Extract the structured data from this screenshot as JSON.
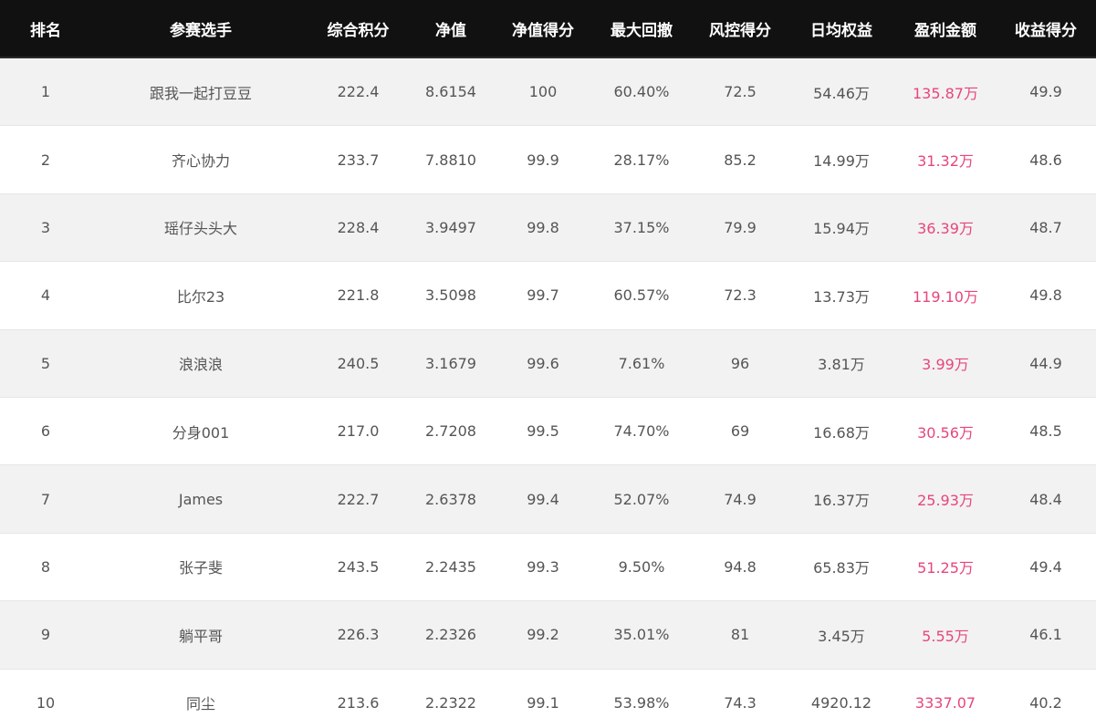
{
  "headers": [
    "排名",
    "参赛选手",
    "综合积分",
    "净值",
    "净值得分",
    "最大回撤",
    "风控得分",
    "日均权益",
    "盈利金额",
    "收益得分"
  ],
  "rows": [
    [
      "1",
      "跟我一起打豆豆",
      "222.4",
      "8.6154",
      "100",
      "60.40%",
      "72.5",
      "54.46万",
      "135.87万",
      "49.9"
    ],
    [
      "2",
      "齐心协力",
      "233.7",
      "7.8810",
      "99.9",
      "28.17%",
      "85.2",
      "14.99万",
      "31.32万",
      "48.6"
    ],
    [
      "3",
      "瑶仔头头大",
      "228.4",
      "3.9497",
      "99.8",
      "37.15%",
      "79.9",
      "15.94万",
      "36.39万",
      "48.7"
    ],
    [
      "4",
      "比尔23",
      "221.8",
      "3.5098",
      "99.7",
      "60.57%",
      "72.3",
      "13.73万",
      "119.10万",
      "49.8"
    ],
    [
      "5",
      "浪浪浪",
      "240.5",
      "3.1679",
      "99.6",
      "7.61%",
      "96",
      "3.81万",
      "3.99万",
      "44.9"
    ],
    [
      "6",
      "分身001",
      "217.0",
      "2.7208",
      "99.5",
      "74.70%",
      "69",
      "16.68万",
      "30.56万",
      "48.5"
    ],
    [
      "7",
      "James",
      "222.7",
      "2.6378",
      "99.4",
      "52.07%",
      "74.9",
      "16.37万",
      "25.93万",
      "48.4"
    ],
    [
      "8",
      "张子斐",
      "243.5",
      "2.2435",
      "99.3",
      "9.50%",
      "94.8",
      "65.83万",
      "51.25万",
      "49.4"
    ],
    [
      "9",
      "躺平哥",
      "226.3",
      "2.2326",
      "99.2",
      "35.01%",
      "81",
      "3.45万",
      "5.55万",
      "46.1"
    ],
    [
      "10",
      "同尘",
      "213.6",
      "2.2322",
      "99.1",
      "53.98%",
      "74.3",
      "4920.12",
      "3337.07",
      "40.2"
    ]
  ],
  "colors": {
    "header_bg": "#111111",
    "header_text": "#ffffff",
    "row_alt_bg": "#f2f2f2",
    "text": "#555555",
    "profit_text": "#e8457c"
  }
}
